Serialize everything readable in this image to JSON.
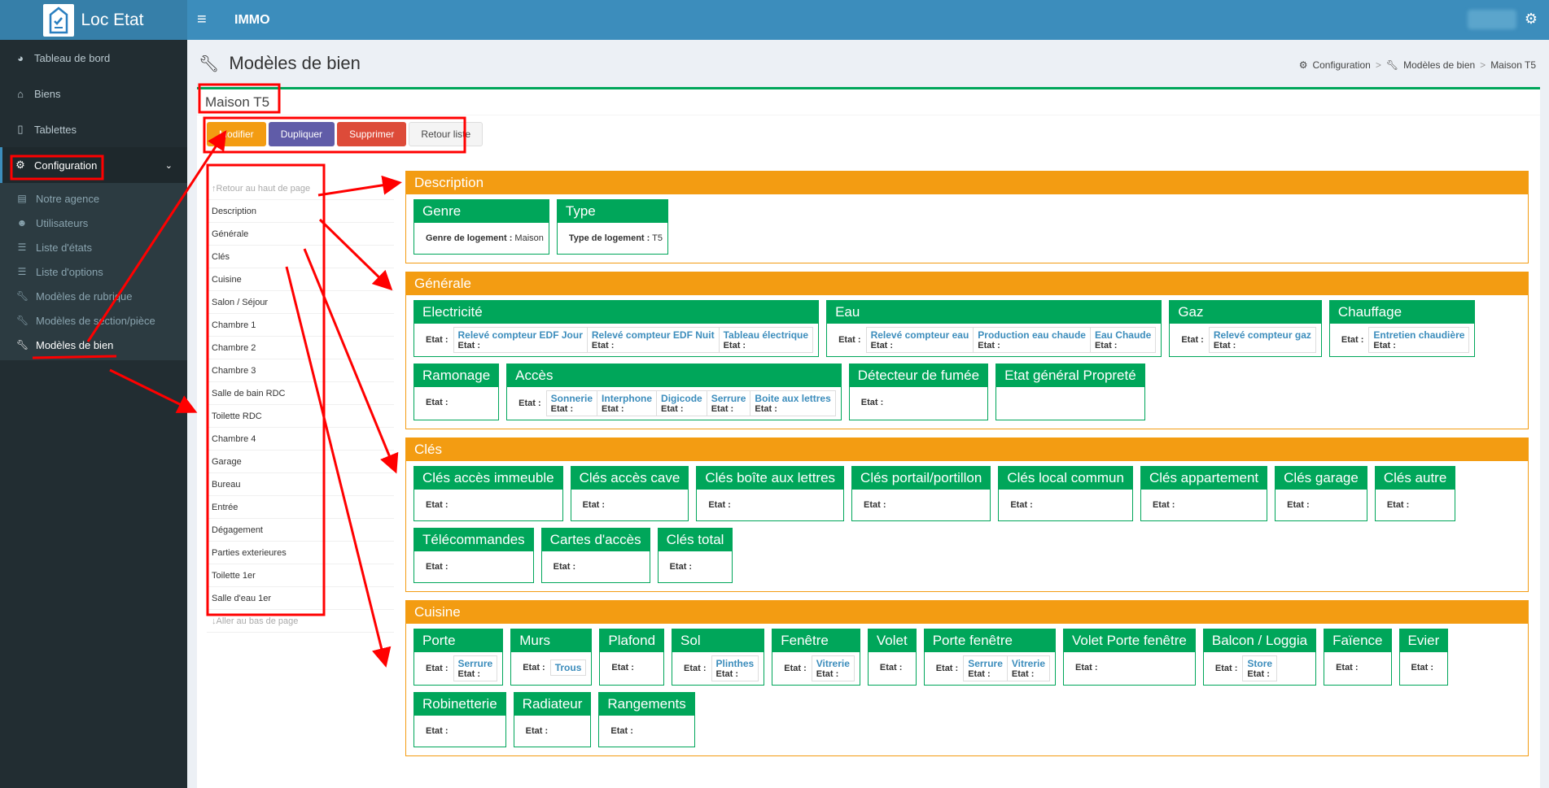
{
  "topbar": {
    "app_title": "Loc Etat",
    "app_name": "IMMO"
  },
  "sidebar": {
    "items": [
      {
        "label": "Tableau de bord",
        "icon": "dashboard-icon"
      },
      {
        "label": "Biens",
        "icon": "home-icon"
      },
      {
        "label": "Tablettes",
        "icon": "tablet-icon"
      },
      {
        "label": "Configuration",
        "icon": "gears-icon"
      }
    ],
    "subitems": [
      {
        "label": "Notre agence",
        "icon": "building-icon"
      },
      {
        "label": "Utilisateurs",
        "icon": "users-icon"
      },
      {
        "label": "Liste d'états",
        "icon": "list-icon"
      },
      {
        "label": "Liste d'options",
        "icon": "list-icon"
      },
      {
        "label": "Modèles de rubrique",
        "icon": "wrench-icon"
      },
      {
        "label": "Modèles de section/pièce",
        "icon": "wrench-icon"
      },
      {
        "label": "Modèles de bien",
        "icon": "wrench-icon"
      }
    ]
  },
  "page": {
    "title": "Modèles de bien"
  },
  "breadcrumb": [
    "Configuration",
    "Modèles de bien",
    "Maison T5"
  ],
  "box": {
    "title": "Maison T5"
  },
  "actions": {
    "edit": "Modifier",
    "duplicate": "Dupliquer",
    "delete": "Supprimer",
    "back": "Retour liste"
  },
  "secnav": {
    "top": "Retour au haut de page",
    "bottom": "Aller au bas de page",
    "items": [
      "Description",
      "Générale",
      "Clés",
      "Cuisine",
      "Salon / Séjour",
      "Chambre 1",
      "Chambre 2",
      "Chambre 3",
      "Salle de bain RDC",
      "Toilette RDC",
      "Chambre 4",
      "Garage",
      "Bureau",
      "Entrée",
      "Dégagement",
      "Parties exterieures",
      "Toilette 1er",
      "Salle d'eau 1er"
    ]
  },
  "labels": {
    "etat": "Etat :"
  },
  "sections": [
    {
      "title": "Description",
      "cards": [
        {
          "title": "Genre",
          "info_label": "Genre de logement :",
          "info_value": "Maison"
        },
        {
          "title": "Type",
          "info_label": "Type de logement :",
          "info_value": "T5"
        }
      ]
    },
    {
      "title": "Générale",
      "cards": [
        {
          "title": "Electricité",
          "options": [
            "Relevé compteur EDF Jour",
            "Relevé compteur EDF Nuit",
            "Tableau électrique"
          ]
        },
        {
          "title": "Eau",
          "options": [
            "Relevé compteur eau",
            "Production eau chaude",
            "Eau Chaude"
          ]
        },
        {
          "title": "Gaz",
          "options": [
            "Relevé compteur gaz"
          ]
        },
        {
          "title": "Chauffage",
          "options": [
            "Entretien chaudière"
          ]
        },
        {
          "title": "Ramonage",
          "options": []
        },
        {
          "title": "Accès",
          "options": [
            "Sonnerie",
            "Interphone",
            "Digicode",
            "Serrure",
            "Boite aux lettres"
          ]
        },
        {
          "title": "Détecteur de fumée",
          "options": []
        },
        {
          "title": "Etat général Propreté",
          "options": [],
          "empty": true
        }
      ]
    },
    {
      "title": "Clés",
      "cards": [
        {
          "title": "Clés accès immeuble",
          "options": []
        },
        {
          "title": "Clés accès cave",
          "options": []
        },
        {
          "title": "Clés boîte aux lettres",
          "options": []
        },
        {
          "title": "Clés portail/portillon",
          "options": []
        },
        {
          "title": "Clés local commun",
          "options": []
        },
        {
          "title": "Clés appartement",
          "options": []
        },
        {
          "title": "Clés garage",
          "options": []
        },
        {
          "title": "Clés autre",
          "options": []
        },
        {
          "title": "Télécommandes",
          "options": []
        },
        {
          "title": "Cartes d'accès",
          "options": []
        },
        {
          "title": "Clés total",
          "options": []
        }
      ]
    },
    {
      "title": "Cuisine",
      "cards": [
        {
          "title": "Porte",
          "options": [
            "Serrure"
          ]
        },
        {
          "title": "Murs",
          "options": [
            "Trous"
          ],
          "noetat": true
        },
        {
          "title": "Plafond",
          "options": []
        },
        {
          "title": "Sol",
          "options": [
            "Plinthes"
          ]
        },
        {
          "title": "Fenêtre",
          "options": [
            "Vitrerie"
          ]
        },
        {
          "title": "Volet",
          "options": []
        },
        {
          "title": "Porte fenêtre",
          "options": [
            "Serrure",
            "Vitrerie"
          ]
        },
        {
          "title": "Volet Porte fenêtre",
          "options": []
        },
        {
          "title": "Balcon / Loggia",
          "options": [
            "Store"
          ]
        },
        {
          "title": "Faïence",
          "options": []
        },
        {
          "title": "Evier",
          "options": []
        },
        {
          "title": "Robinetterie",
          "options": []
        },
        {
          "title": "Radiateur",
          "options": []
        },
        {
          "title": "Rangements",
          "options": []
        }
      ]
    }
  ]
}
